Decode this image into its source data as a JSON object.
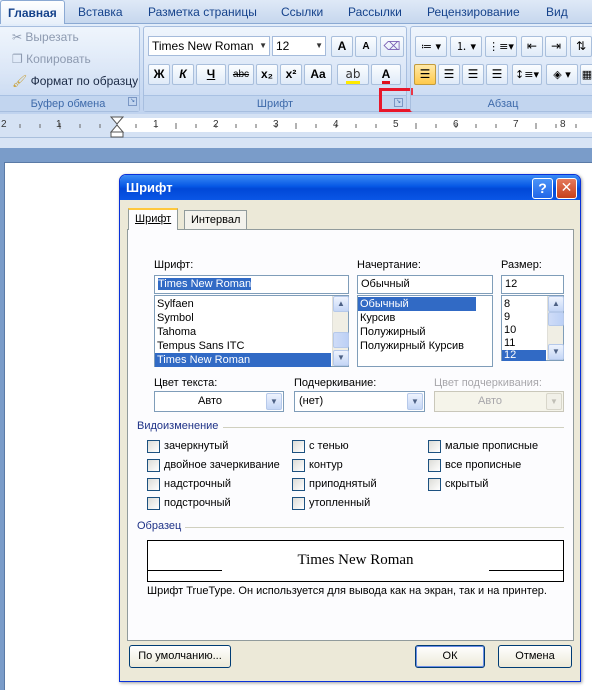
{
  "ribbon": {
    "tabs": [
      "Главная",
      "Вставка",
      "Разметка страницы",
      "Ссылки",
      "Рассылки",
      "Рецензирование",
      "Вид"
    ],
    "clipboard": {
      "cut": "Вырезать",
      "copy": "Копировать",
      "format_painter": "Формат по образцу",
      "group_label": "Буфер обмена"
    },
    "font": {
      "name": "Times New Roman",
      "size": "12",
      "group_label": "Шрифт"
    },
    "paragraph": {
      "group_label": "Абзац"
    },
    "font_buttons": {
      "bold": "Ж",
      "italic": "К",
      "underline": "Ч",
      "strike": "abc",
      "subscript": "x₂",
      "superscript": "x²",
      "change_case": "Aa",
      "grow": "A",
      "shrink": "A",
      "font_color": "A"
    }
  },
  "ruler": {
    "marks": [
      "2",
      "1",
      "1",
      "2",
      "3",
      "4",
      "5",
      "6",
      "7",
      "8"
    ]
  },
  "dialog": {
    "title": "Шрифт",
    "help": "?",
    "close": "✕",
    "tabs": [
      "Шрифт",
      "Интервал"
    ],
    "font_label": "Шрифт:",
    "font_value": "Times New Roman",
    "font_list": [
      "Sylfaen",
      "Symbol",
      "Tahoma",
      "Tempus Sans ITC",
      "Times New Roman"
    ],
    "font_selected_index": 4,
    "style_label": "Начертание:",
    "style_value": "Обычный",
    "style_list": [
      "Обычный",
      "Курсив",
      "Полужирный",
      "Полужирный Курсив"
    ],
    "style_selected_index": 0,
    "size_label": "Размер:",
    "size_value": "12",
    "size_list": [
      "8",
      "9",
      "10",
      "11",
      "12"
    ],
    "size_selected_index": 4,
    "color_label": "Цвет текста:",
    "color_value": "Авто",
    "underline_label": "Подчеркивание:",
    "underline_value": "(нет)",
    "underline_color_label": "Цвет подчеркивания:",
    "underline_color_value": "Авто",
    "effects_label": "Видоизменение",
    "effects": [
      {
        "label": "зачеркнутый",
        "checked": false
      },
      {
        "label": "двойное зачеркивание",
        "checked": false
      },
      {
        "label": "надстрочный",
        "checked": false
      },
      {
        "label": "подстрочный",
        "checked": false
      },
      {
        "label": "с тенью",
        "checked": false
      },
      {
        "label": "контур",
        "checked": false
      },
      {
        "label": "приподнятый",
        "checked": false
      },
      {
        "label": "утопленный",
        "checked": false
      },
      {
        "label": "малые прописные",
        "checked": false
      },
      {
        "label": "все прописные",
        "checked": false
      },
      {
        "label": "скрытый",
        "checked": false
      }
    ],
    "sample_label": "Образец",
    "sample_text": "Times New Roman",
    "note": "Шрифт TrueType. Он используется для вывода как на экран, так и на принтер.",
    "default_button": "По умолчанию...",
    "ok_button": "ОК",
    "cancel_button": "Отмена"
  }
}
